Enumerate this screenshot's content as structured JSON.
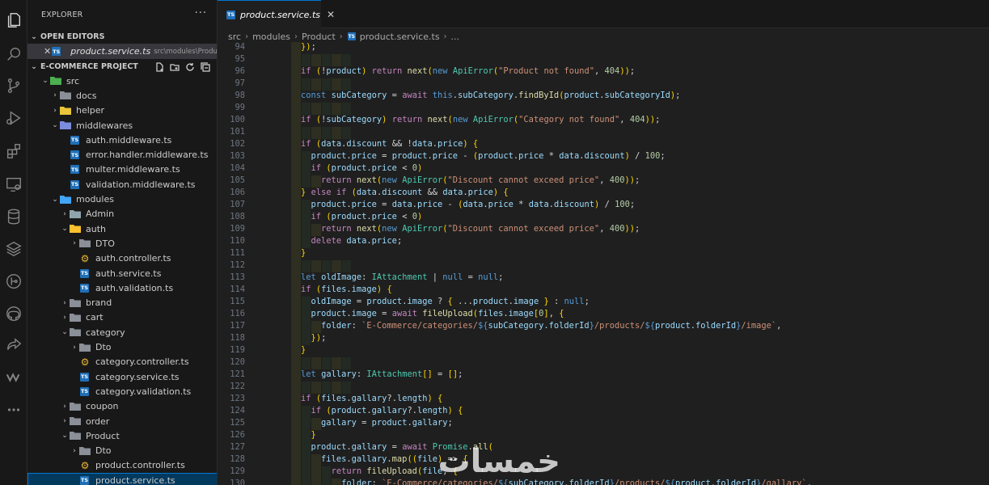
{
  "explorer": {
    "title": "EXPLORER",
    "more": "···",
    "open_editors_header": "OPEN EDITORS",
    "open_editor": {
      "name": "product.service.ts",
      "path": "src\\modules\\Product"
    },
    "project_header": "E-COMMERCE PROJECT"
  },
  "tree": [
    {
      "label": "src",
      "depth": 0,
      "kind": "folder-src",
      "open": true
    },
    {
      "label": "docs",
      "depth": 1,
      "kind": "folder",
      "open": false
    },
    {
      "label": "helper",
      "depth": 1,
      "kind": "folder-yellow",
      "open": false
    },
    {
      "label": "middlewares",
      "depth": 1,
      "kind": "folder-mw",
      "open": true
    },
    {
      "label": "auth.middleware.ts",
      "depth": 2,
      "kind": "ts"
    },
    {
      "label": "error.handler.middleware.ts",
      "depth": 2,
      "kind": "ts"
    },
    {
      "label": "multer.middleware.ts",
      "depth": 2,
      "kind": "ts"
    },
    {
      "label": "validation.middleware.ts",
      "depth": 2,
      "kind": "ts"
    },
    {
      "label": "modules",
      "depth": 1,
      "kind": "folder-mod",
      "open": true
    },
    {
      "label": "Admin",
      "depth": 2,
      "kind": "folder-admin",
      "open": false
    },
    {
      "label": "auth",
      "depth": 2,
      "kind": "folder-auth",
      "open": true
    },
    {
      "label": "DTO",
      "depth": 3,
      "kind": "folder",
      "open": false
    },
    {
      "label": "auth.controller.ts",
      "depth": 3,
      "kind": "gear"
    },
    {
      "label": "auth.service.ts",
      "depth": 3,
      "kind": "ts"
    },
    {
      "label": "auth.validation.ts",
      "depth": 3,
      "kind": "ts"
    },
    {
      "label": "brand",
      "depth": 2,
      "kind": "folder",
      "open": false
    },
    {
      "label": "cart",
      "depth": 2,
      "kind": "folder",
      "open": false
    },
    {
      "label": "category",
      "depth": 2,
      "kind": "folder",
      "open": true
    },
    {
      "label": "Dto",
      "depth": 3,
      "kind": "folder",
      "open": false
    },
    {
      "label": "category.controller.ts",
      "depth": 3,
      "kind": "gear"
    },
    {
      "label": "category.service.ts",
      "depth": 3,
      "kind": "ts"
    },
    {
      "label": "category.validation.ts",
      "depth": 3,
      "kind": "ts"
    },
    {
      "label": "coupon",
      "depth": 2,
      "kind": "folder",
      "open": false
    },
    {
      "label": "order",
      "depth": 2,
      "kind": "folder",
      "open": false
    },
    {
      "label": "Product",
      "depth": 2,
      "kind": "folder",
      "open": true
    },
    {
      "label": "Dto",
      "depth": 3,
      "kind": "folder",
      "open": false
    },
    {
      "label": "product.controller.ts",
      "depth": 3,
      "kind": "gear"
    },
    {
      "label": "product.service.ts",
      "depth": 3,
      "kind": "ts",
      "selected": true
    }
  ],
  "tab": {
    "label": "product.service.ts",
    "close": "✕"
  },
  "breadcrumbs": [
    "src",
    "modules",
    "Product",
    "product.service.ts",
    "..."
  ],
  "code": {
    "first_line": 94,
    "lines": [
      "    });",
      "",
      "    if (!product) return next(new ApiError(\"Product not found\", 404));",
      "",
      "    const subCategory = await this.subCategory.findById(product.subCategoryId);",
      "",
      "    if (!subCategory) return next(new ApiError(\"Category not found\", 404));",
      "",
      "    if (data.discount && !data.price) {",
      "      product.price = product.price - (product.price * data.discount) / 100;",
      "      if (product.price < 0)",
      "        return next(new ApiError(\"Discount cannot exceed price\", 400));",
      "    } else if (data.discount && data.price) {",
      "      product.price = data.price - (data.price * data.discount) / 100;",
      "      if (product.price < 0)",
      "        return next(new ApiError(\"Discount cannot exceed price\", 400));",
      "      delete data.price;",
      "    }",
      "",
      "    let oldImage: IAttachment | null = null;",
      "    if (files.image) {",
      "      oldImage = product.image ? { ...product.image } : null;",
      "      product.image = await fileUpload(files.image[0], {",
      "        folder: `E-Commerce/categories/${subCategory.folderId}/products/${product.folderId}/image`,",
      "      });",
      "    }",
      "",
      "    let gallary: IAttachment[] = [];",
      "",
      "    if (files.gallary?.length) {",
      "      if (product.gallary?.length) {",
      "        gallary = product.gallary;",
      "      }",
      "      product.gallary = await Promise.all(",
      "        files.gallary.map((file) => {",
      "          return fileUpload(file, {",
      "            folder: `E-Commerce/categories/${subCategory.folderId}/products/${product.folderId}/gallary`,"
    ]
  },
  "watermark": "خمسات"
}
